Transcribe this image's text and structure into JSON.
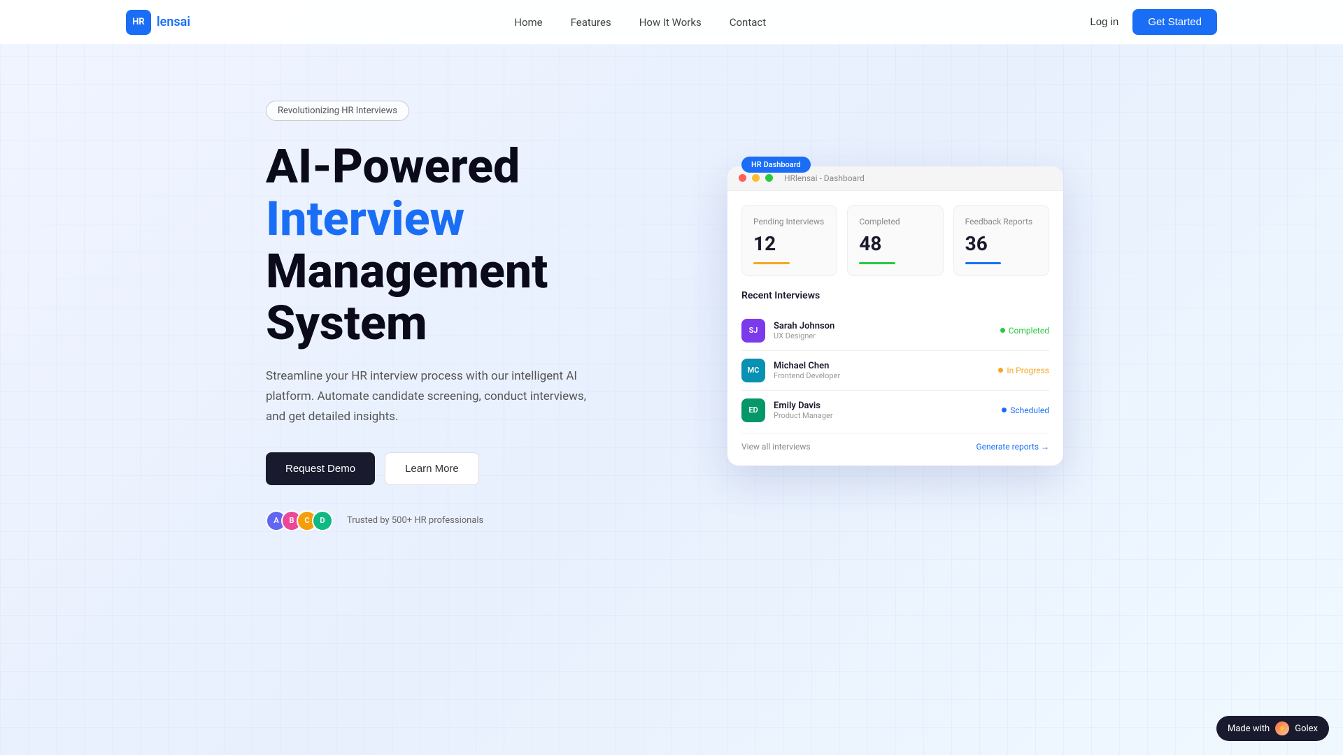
{
  "nav": {
    "logo_initials": "HR",
    "logo_name_plain": "lens",
    "logo_name_accent": "ai",
    "links": [
      "Home",
      "Features",
      "How It Works",
      "Contact"
    ],
    "login_label": "Log in",
    "get_started_label": "Get Started"
  },
  "hero": {
    "badge": "Revolutionizing HR Interviews",
    "title_line1": "AI-Powered",
    "title_line2_accent": "Interview",
    "title_line3": "Management",
    "title_line4": "System",
    "subtitle": "Streamline your HR interview process with our intelligent AI platform. Automate candidate screening, conduct interviews, and get detailed insights.",
    "btn_demo": "Request Demo",
    "btn_learn": "Learn More",
    "trust_text": "Trusted by 500+ HR professionals",
    "trust_avatars": [
      "A",
      "B",
      "C",
      "D"
    ]
  },
  "dashboard": {
    "badge": "HR Dashboard",
    "window_title": "HRlensai - Dashboard",
    "stats": [
      {
        "label": "Pending Interviews",
        "value": "12",
        "bar_class": "bar-yellow"
      },
      {
        "label": "Completed",
        "value": "48",
        "bar_class": "bar-green"
      },
      {
        "label": "Feedback Reports",
        "value": "36",
        "bar_class": "bar-blue"
      }
    ],
    "recent_title": "Recent Interviews",
    "interviews": [
      {
        "initials": "SJ",
        "name": "Sarah Johnson",
        "role": "UX Designer",
        "status": "Completed",
        "status_class": "status-completed",
        "dot_class": "dot-completed",
        "av_class": "av-sj"
      },
      {
        "initials": "MC",
        "name": "Michael Chen",
        "role": "Frontend Developer",
        "status": "In Progress",
        "status_class": "status-inprogress",
        "dot_class": "dot-inprogress",
        "av_class": "av-mc"
      },
      {
        "initials": "ED",
        "name": "Emily Davis",
        "role": "Product Manager",
        "status": "Scheduled",
        "status_class": "status-scheduled",
        "dot_class": "dot-scheduled",
        "av_class": "av-ed"
      }
    ],
    "view_all": "View all interviews",
    "generate": "Generate reports →"
  },
  "golex": {
    "text": "Made with",
    "brand": "Golex"
  }
}
